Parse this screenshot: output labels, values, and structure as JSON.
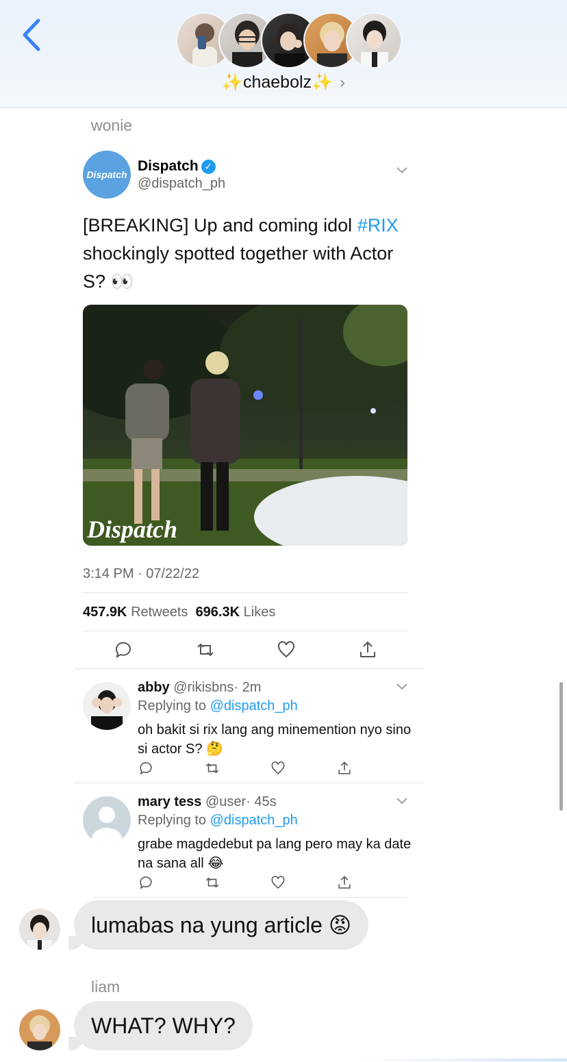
{
  "header": {
    "group_name": "✨chaebolz✨",
    "chevron": "›",
    "back_icon": "chevron-left-icon",
    "accent": "#3a82f7"
  },
  "thread": {
    "sender_1": "wonie",
    "sender_2": "liam"
  },
  "tweet": {
    "avatar_label": "Dispatch",
    "name": "Dispatch",
    "verified_mark": "✓",
    "handle": "@dispatch_ph",
    "text_before": "[BREAKING] Up and coming idol ",
    "hashtag": "#RIX",
    "text_after": " shockingly spotted together with Actor S? 👀",
    "photo_watermark": "Dispatch",
    "timestamp": "3:14 PM · 07/22/22",
    "retweets_count": "457.9K",
    "retweets_label": "Retweets",
    "likes_count": "696.3K",
    "likes_label": "Likes"
  },
  "replies": [
    {
      "name": "abby",
      "handle": "@rikisbns",
      "time": "· 2m",
      "replying_prefix": "Replying to ",
      "replying_to": "@dispatch_ph",
      "text": "oh bakit si rix lang ang minemention nyo sino si actor S? 🤔"
    },
    {
      "name": "mary tess",
      "handle": "@user",
      "time": "· 45s",
      "replying_prefix": "Replying to ",
      "replying_to": "@dispatch_ph",
      "text": "grabe magdedebut pa lang pero may ka date na sana all 😂"
    }
  ],
  "messages": [
    {
      "text": "lumabas na yung article 😡"
    },
    {
      "text": "WHAT? WHY?"
    }
  ]
}
